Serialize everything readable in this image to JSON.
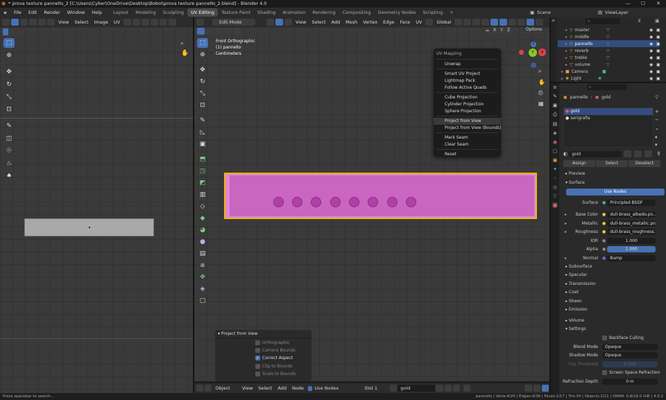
{
  "window": {
    "title": "* prova texture pannello_2 [C:\\Users\\Cyber\\OneDrive\\Desktop\\Bobol\\prova texture pannello_2.blend] - Blender 4.0",
    "minimize": "—",
    "maximize": "☐",
    "close": "✕"
  },
  "menubar": {
    "items": [
      "File",
      "Edit",
      "Render",
      "Window",
      "Help"
    ],
    "workspaces": [
      "Layout",
      "Modeling",
      "Sculpting",
      "UV Editing",
      "Texture Paint",
      "Shading",
      "Animation",
      "Rendering",
      "Compositing",
      "Geometry Nodes",
      "Scripting"
    ],
    "active_workspace": "UV Editing",
    "add_tab": "+",
    "scene": "Scene",
    "viewlayer": "ViewLayer"
  },
  "uv_editor": {
    "menus": [
      "View",
      "Select",
      "Image",
      "UV"
    ]
  },
  "viewport": {
    "mode": "Edit Mode",
    "menus": [
      "View",
      "Select",
      "Add",
      "Mesh",
      "Vertex",
      "Edge",
      "Face",
      "UV"
    ],
    "transform_orientation": "Global",
    "options": "Options",
    "xyz": [
      "X",
      "Y",
      "Z"
    ],
    "overlay_text": [
      "Front Orthographic",
      "(1) pannello",
      "Centimeters"
    ],
    "gizmo": {
      "x": "X",
      "y": "Y",
      "z": "Z"
    }
  },
  "uv_menu": {
    "title": "UV Mapping",
    "items": [
      "Unwrap",
      "Smart UV Project",
      "Lightmap Pack",
      "Follow Active Quads",
      "Cube Projection",
      "Cylinder Projection",
      "Sphere Projection",
      "Project from View",
      "Project from View (Bounds)",
      "Mark Seam",
      "Clear Seam",
      "Reset"
    ],
    "highlighted": "Project from View"
  },
  "redo_panel": {
    "title": "Project from View",
    "options": [
      {
        "label": "Orthographic",
        "checked": false
      },
      {
        "label": "Camera Bounds",
        "checked": false
      },
      {
        "label": "Correct Aspect",
        "checked": true
      },
      {
        "label": "Clip to Bounds",
        "checked": false
      },
      {
        "label": "Scale to Bounds",
        "checked": false
      }
    ]
  },
  "shader_header": {
    "object": "Object",
    "menus": [
      "View",
      "Select",
      "Add",
      "Node"
    ],
    "use_nodes": "Use Nodes",
    "slot": "Slot 1",
    "material": "gold"
  },
  "outliner": {
    "items": [
      {
        "name": "master",
        "icon": "▽"
      },
      {
        "name": "middle",
        "icon": "▽"
      },
      {
        "name": "pannello",
        "icon": "▽"
      },
      {
        "name": "reverb",
        "icon": "▽"
      },
      {
        "name": "treble",
        "icon": "▽"
      },
      {
        "name": "volume",
        "icon": "▽"
      },
      {
        "name": "Camera",
        "icon": "■"
      },
      {
        "name": "Light",
        "icon": "✺"
      }
    ],
    "selected": "pannello"
  },
  "properties": {
    "breadcrumb_object": "pannello",
    "breadcrumb_material": "gold",
    "slots": [
      "gold",
      "serigrafia"
    ],
    "material_name": "gold",
    "tabs": [
      "Assign",
      "Select",
      "Deselect"
    ],
    "preview": "Preview",
    "surface": "Surface",
    "use_nodes": "Use Nodes",
    "surface_value": "Principled BSDF",
    "inputs": [
      {
        "label": "Base Color",
        "value": "dull-brass_albedo.pn..."
      },
      {
        "label": "Metallic",
        "value": "dull-brass_metallic.png"
      },
      {
        "label": "Roughness",
        "value": "dull-brass_roughness...."
      },
      {
        "label": "IOR",
        "value": "1.000"
      },
      {
        "label": "Alpha",
        "value": "1.000"
      },
      {
        "label": "Normal",
        "value": "Bump"
      }
    ],
    "subsections": [
      "Subsurface",
      "Specular",
      "Transmission",
      "Coat",
      "Sheen",
      "Emission"
    ],
    "volume": "Volume",
    "settings": "Settings",
    "backface": "Backface Culling",
    "blend_mode_label": "Blend Mode",
    "blend_mode": "Opaque",
    "shadow_mode_label": "Shadow Mode",
    "shadow_mode": "Opaque",
    "clip_label": "Clip Threshold",
    "clip_value": "0.500",
    "ssr": "Screen Space Refraction",
    "refraction_label": "Refraction Depth",
    "refraction_value": "0 m"
  },
  "status": {
    "left": "Press spacebar to search...",
    "right": "pannello | Verts:4/20 | Edges:4/36 | Faces:1/17 | Tris:34 | Objects:1/11 | VRAM: 0.8/16.0 GiB | 4.0.2"
  },
  "colors": {
    "accent": "#4772b3",
    "mesh_face": "#c866c0",
    "mesh_edge": "#ffb000",
    "vertex_dots": "#b23fa7"
  }
}
